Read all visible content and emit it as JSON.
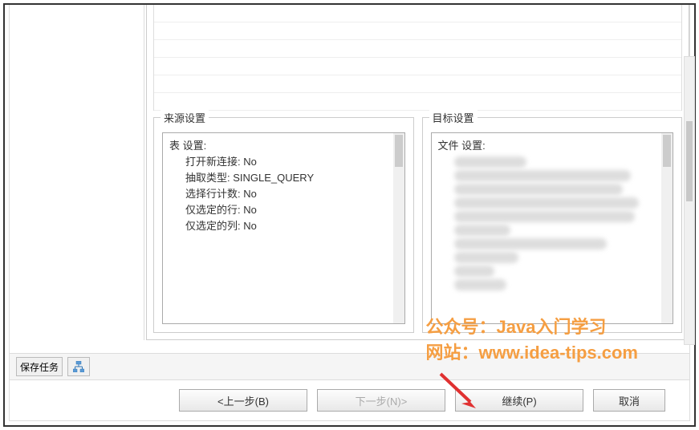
{
  "source_settings": {
    "legend": "来源设置",
    "header": "表 设置:",
    "items": [
      {
        "label": "打开新连接: No"
      },
      {
        "label": "抽取类型: SINGLE_QUERY"
      },
      {
        "label": "选择行计数: No"
      },
      {
        "label": "仅选定的行: No"
      },
      {
        "label": "仅选定的列: No"
      }
    ]
  },
  "target_settings": {
    "legend": "目标设置",
    "header": "文件 设置:"
  },
  "toolbar": {
    "save_task": "保存任务"
  },
  "buttons": {
    "prev": "<上一步(B)",
    "next": "下一步(N)>",
    "continue": "继续(P)",
    "cancel": "取消"
  },
  "watermark": {
    "line1": "公众号：Java入门学习",
    "line2": "网站：www.idea-tips.com"
  }
}
